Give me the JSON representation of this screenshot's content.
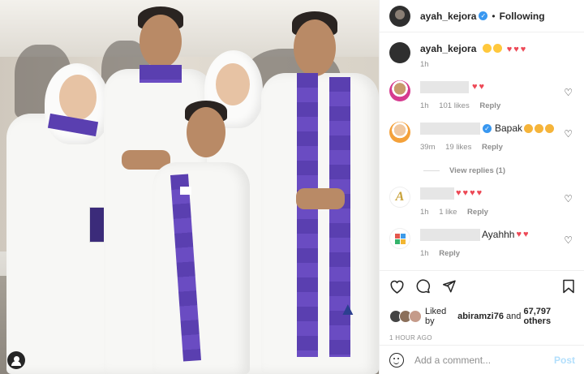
{
  "photo": {
    "overlay_icon": "user-tag-icon"
  },
  "header": {
    "username": "ayah_kejora",
    "separator": "•",
    "follow_state": "Following"
  },
  "caption": {
    "username": "ayah_kejora",
    "time": "1h"
  },
  "comments": [
    {
      "time": "1h",
      "likes": "101 likes",
      "reply": "Reply"
    },
    {
      "text": "Bapak",
      "time": "39m",
      "likes": "19 likes",
      "reply": "Reply"
    },
    {
      "time": "1h",
      "likes": "1 like",
      "reply": "Reply"
    },
    {
      "text": "Ayahhh",
      "time": "1h",
      "reply": "Reply"
    }
  ],
  "view_replies": "View replies (1)",
  "likes": {
    "prefix": "Liked by",
    "user": "abiramzi76",
    "conjunction": "and",
    "others": "67,797 others"
  },
  "timestamp": "1 HOUR AGO",
  "add_comment": {
    "placeholder": "Add a comment...",
    "post_label": "Post"
  },
  "colors": {
    "accent": "#3897f0",
    "heart": "#ed4956",
    "scarf": "#5a3fb0",
    "post_disabled": "#b2dffc"
  },
  "icons": [
    "heart-outline-icon",
    "comment-icon",
    "share-icon",
    "bookmark-icon",
    "emoji-icon",
    "verified-badge-icon"
  ]
}
